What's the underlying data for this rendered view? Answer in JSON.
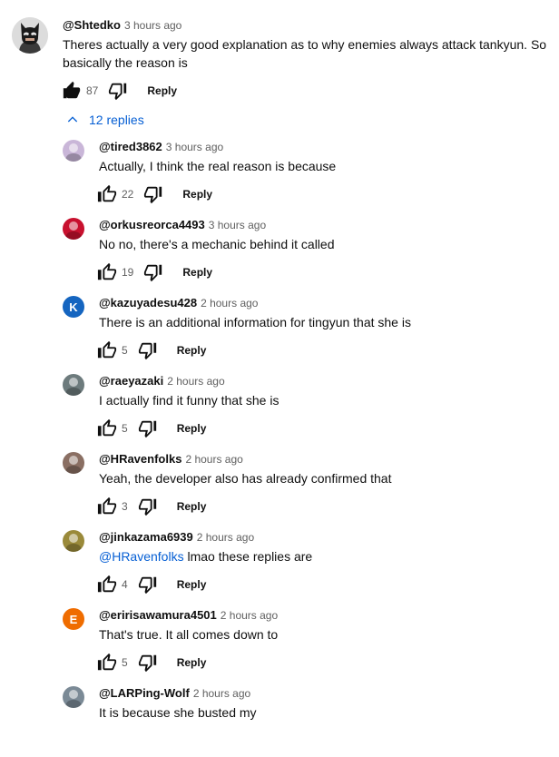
{
  "top_comment": {
    "author": "@Shtedko",
    "time": "3 hours ago",
    "text": "Theres actually a very good explanation as to why enemies always attack tankyun. So basically the reason is",
    "likes": "87",
    "reply_label": "Reply",
    "avatar_icon": "bat-mask-avatar"
  },
  "replies_toggle": {
    "label": "12 replies",
    "icon": "chevron-up-icon"
  },
  "replies": [
    {
      "author": "@tired3862",
      "time": "3 hours ago",
      "text": "Actually, I think the real reason is because",
      "likes": "22",
      "reply_label": "Reply",
      "avatar_color": "#c9b6d8"
    },
    {
      "author": "@orkusreorca4493",
      "time": "3 hours ago",
      "text": "No no, there's a mechanic behind it called",
      "likes": "19",
      "reply_label": "Reply",
      "avatar_color": "#c8102e"
    },
    {
      "author": "@kazuyadesu428",
      "time": "2 hours ago",
      "text": "There is an additional information for tingyun that she is",
      "likes": "5",
      "reply_label": "Reply",
      "avatar_color": "#1565c0",
      "avatar_letter": "K"
    },
    {
      "author": "@raeyazaki",
      "time": "2 hours ago",
      "text": "I actually find it funny that she is",
      "likes": "5",
      "reply_label": "Reply",
      "avatar_color": "#6d7b7d"
    },
    {
      "author": "@HRavenfolks",
      "time": "2 hours ago",
      "text": "Yeah, the developer also has already confirmed that",
      "likes": "3",
      "reply_label": "Reply",
      "avatar_color": "#8a6f63"
    },
    {
      "author": "@jinkazama6939",
      "time": "2 hours ago",
      "mention": "@HRavenfolks",
      "text": "lmao these replies are",
      "likes": "4",
      "reply_label": "Reply",
      "avatar_color": "#9a8a3a"
    },
    {
      "author": "@eririsawamura4501",
      "time": "2 hours ago",
      "text": "That's true. It all comes down to",
      "likes": "5",
      "reply_label": "Reply",
      "avatar_color": "#ef6c00",
      "avatar_letter": "E"
    },
    {
      "author": "@LARPing-Wolf",
      "time": "2 hours ago",
      "text": "It is because she busted my",
      "likes": "",
      "reply_label": "",
      "avatar_color": "#7b8a96"
    }
  ]
}
